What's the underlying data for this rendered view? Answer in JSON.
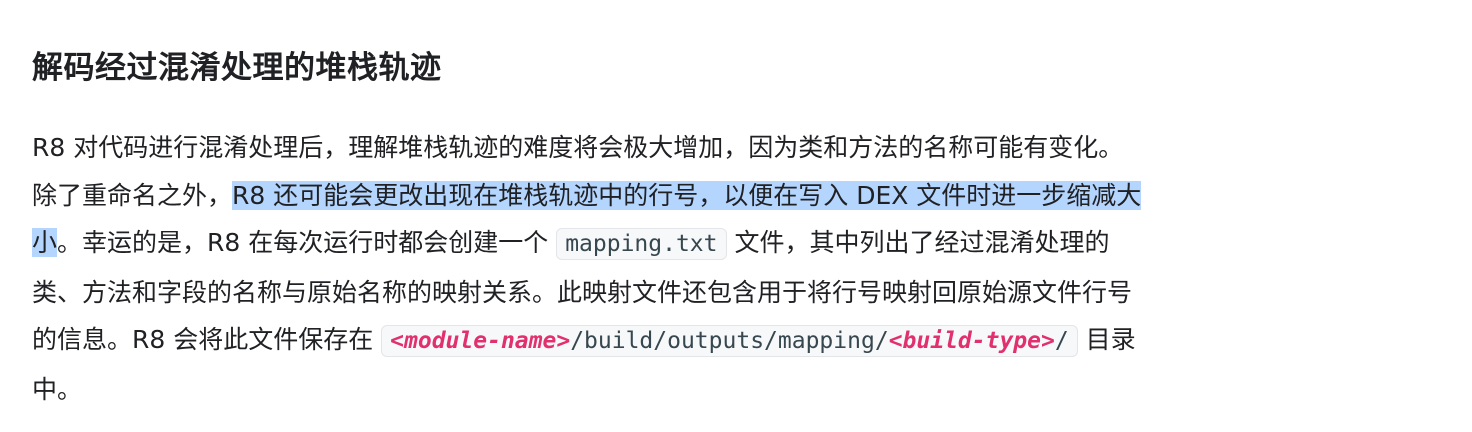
{
  "heading": "解码经过混淆处理的堆栈轨迹",
  "paragraph": [
    [
      {
        "t": "R8 对代码进行混淆处理后，理解堆栈轨迹的难度将会极大增加，因为类和方法的名称可能有变化。"
      }
    ],
    [
      {
        "t": "除了重命名之外，"
      },
      {
        "t": "R8 还可能会更改出现在堆栈轨迹中的行号，以便在写入 DEX 文件时进一步缩减大",
        "k": "hl"
      }
    ],
    [
      {
        "t": "小",
        "k": "hl"
      },
      {
        "t": "。幸运的是，R8 在每次运行时都会创建一个 "
      },
      {
        "k": "code",
        "parts": [
          {
            "t": "mapping.txt"
          }
        ]
      },
      {
        "t": " 文件，其中列出了经过混淆处理的"
      }
    ],
    [
      {
        "t": "类、方法和字段的名称与原始名称的映射关系。此映射文件还包含用于将行号映射回原始源文件行号"
      }
    ],
    [
      {
        "t": "的信息。R8 会将此文件保存在 "
      },
      {
        "k": "code",
        "parts": [
          {
            "t": "<module-name>",
            "em": true
          },
          {
            "t": "/build/outputs/mapping/"
          },
          {
            "t": "<build-type>",
            "em": true
          },
          {
            "t": "/"
          }
        ]
      },
      {
        "t": " 目录"
      }
    ],
    [
      {
        "t": "中。"
      }
    ]
  ],
  "colors": {
    "highlight": "#b4d5fe",
    "code_placeholder": "#e0306d"
  }
}
